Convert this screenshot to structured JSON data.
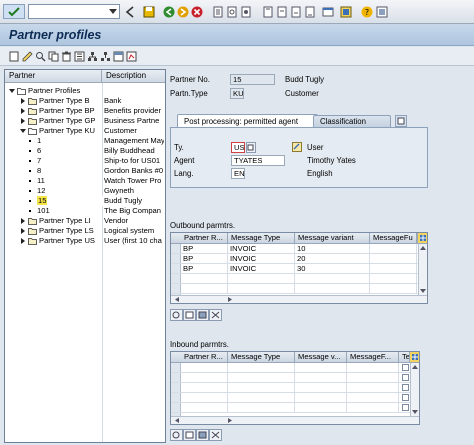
{
  "title": "Partner profiles",
  "tree": {
    "header_partner": "Partner",
    "header_description": "Description",
    "rows": [
      {
        "label": "Partner Profiles",
        "desc": "",
        "level": 0,
        "kind": "folder",
        "expanded": true
      },
      {
        "label": "Partner Type B",
        "desc": "Bank",
        "level": 1,
        "kind": "folder",
        "expanded": false
      },
      {
        "label": "Partner Type BP",
        "desc": "Benefits provider",
        "level": 1,
        "kind": "folder",
        "expanded": false
      },
      {
        "label": "Partner Type GP",
        "desc": "Business Partne",
        "level": 1,
        "kind": "folder",
        "expanded": false
      },
      {
        "label": "Partner Type KU",
        "desc": "Customer",
        "level": 1,
        "kind": "folder",
        "expanded": true
      },
      {
        "label": "1",
        "desc": "Management May",
        "level": 2,
        "kind": "leaf"
      },
      {
        "label": "6",
        "desc": "Billy Buddhead",
        "level": 2,
        "kind": "leaf"
      },
      {
        "label": "7",
        "desc": "Ship-to for US01",
        "level": 2,
        "kind": "leaf"
      },
      {
        "label": "8",
        "desc": "Gordon Banks #0",
        "level": 2,
        "kind": "leaf"
      },
      {
        "label": "11",
        "desc": "Watch Tower Pro",
        "level": 2,
        "kind": "leaf"
      },
      {
        "label": "12",
        "desc": "Gwyneth",
        "level": 2,
        "kind": "leaf"
      },
      {
        "label": "15",
        "desc": "Budd Tugly",
        "level": 2,
        "kind": "leaf",
        "selected": true
      },
      {
        "label": "101",
        "desc": "The Big Compan",
        "level": 2,
        "kind": "leaf"
      },
      {
        "label": "Partner Type LI",
        "desc": "Vendor",
        "level": 1,
        "kind": "folder",
        "expanded": false
      },
      {
        "label": "Partner Type LS",
        "desc": "Logical system",
        "level": 1,
        "kind": "folder",
        "expanded": false
      },
      {
        "label": "Partner Type US",
        "desc": "User (first 10 cha",
        "level": 1,
        "kind": "folder",
        "expanded": false
      }
    ]
  },
  "partner": {
    "no_label": "Partner No.",
    "no_value": "15",
    "no_desc": "Budd Tugly",
    "type_label": "Partn.Type",
    "type_value": "KU",
    "type_desc": "Customer"
  },
  "tabs": {
    "active": "Post processing: permitted agent",
    "inactive": "Classification"
  },
  "agent": {
    "ty_label": "Ty.",
    "ty_value": "US",
    "ty_desc": "User",
    "agent_label": "Agent",
    "agent_value": "TYATES",
    "agent_desc": "Timothy Yates",
    "lang_label": "Lang.",
    "lang_value": "EN",
    "lang_desc": "English"
  },
  "outbound": {
    "title": "Outbound parmtrs.",
    "columns": [
      "Partner R...",
      "Message Type",
      "Message variant",
      "MessageFu"
    ],
    "rows": [
      [
        "BP",
        "INVOIC",
        "10",
        ""
      ],
      [
        "BP",
        "INVOIC",
        "20",
        ""
      ],
      [
        "BP",
        "INVOIC",
        "30",
        ""
      ]
    ]
  },
  "inbound": {
    "title": "Inbound parmtrs.",
    "columns": [
      "Partner R...",
      "Message Type",
      "Message v...",
      "MessageF...",
      "Tes"
    ]
  }
}
